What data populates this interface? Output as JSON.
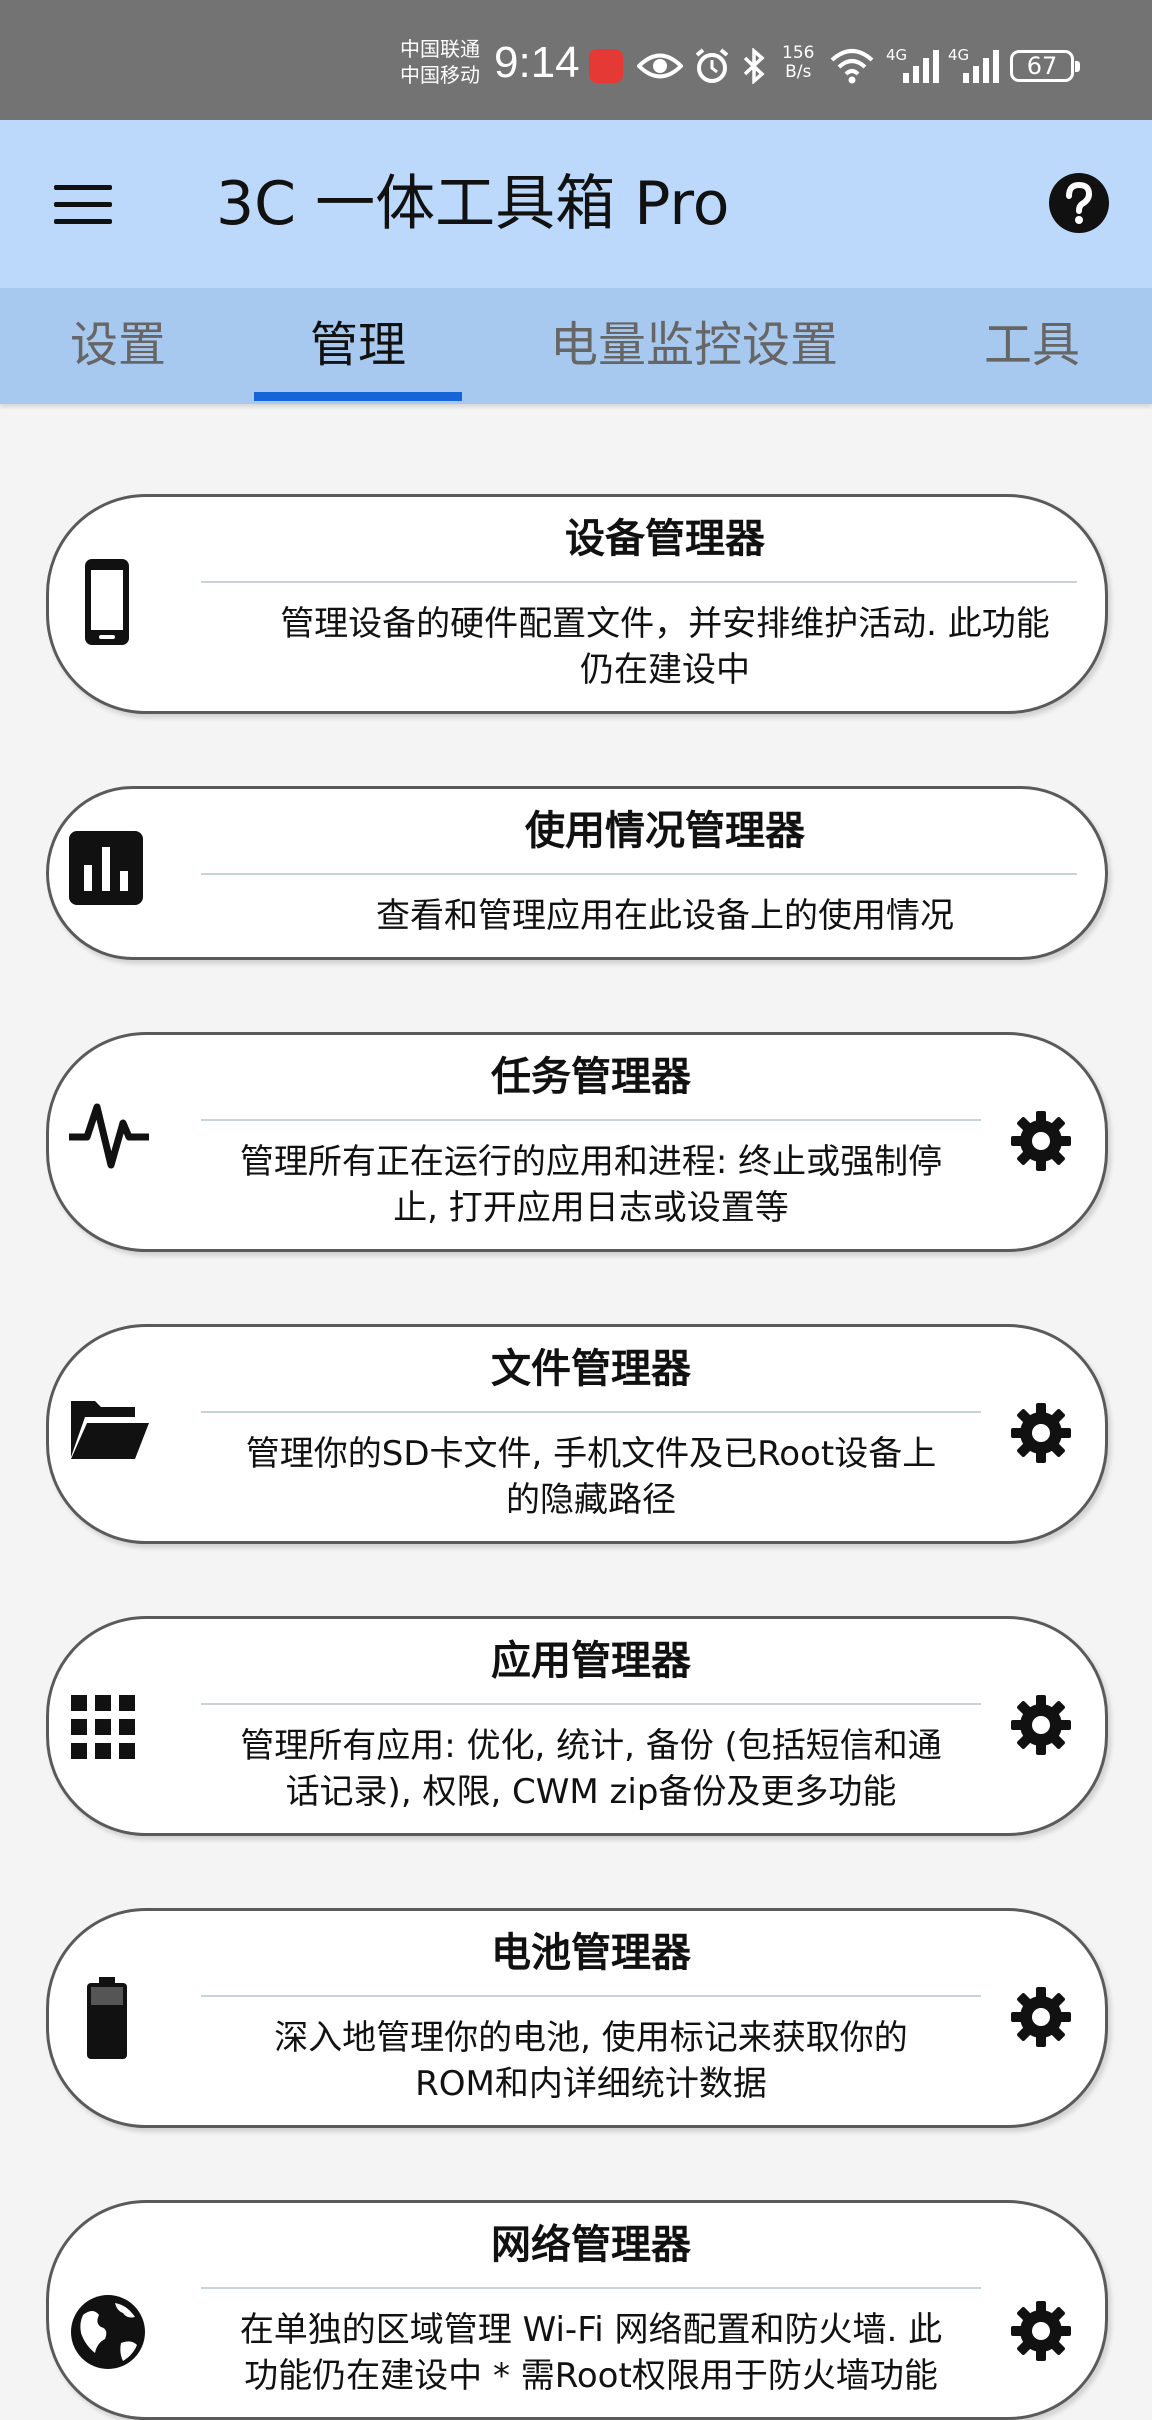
{
  "status_bar": {
    "carrier_1": "中国联通",
    "carrier_2": "中国移动",
    "time": "9:14",
    "net_speed_value": "156",
    "net_speed_unit": "B/s",
    "network_1": "4G",
    "network_2": "4G",
    "battery": "67"
  },
  "app_bar": {
    "title": "3C 一体工具箱 Pro"
  },
  "tabs": [
    {
      "label": "设置",
      "active": false
    },
    {
      "label": "管理",
      "active": true
    },
    {
      "label": "电量监控设置",
      "active": false
    },
    {
      "label": "工具",
      "active": false
    }
  ],
  "cards": [
    {
      "title": "设备管理器",
      "icon": "phone-icon",
      "has_settings": false,
      "desc": [
        "管理设备的硬件配置文件，并安排维护活动. 此功能",
        "仍在建设中"
      ]
    },
    {
      "title": "使用情况管理器",
      "icon": "bar-chart-icon",
      "has_settings": false,
      "desc": [
        "查看和管理应用在此设备上的使用情况"
      ]
    },
    {
      "title": "任务管理器",
      "icon": "activity-icon",
      "has_settings": true,
      "desc": [
        "管理所有正在运行的应用和进程: 终止或强制停",
        "止, 打开应用日志或设置等"
      ]
    },
    {
      "title": "文件管理器",
      "icon": "folder-open-icon",
      "has_settings": true,
      "desc": [
        "管理你的SD卡文件, 手机文件及已Root设备上",
        "的隐藏路径"
      ]
    },
    {
      "title": "应用管理器",
      "icon": "apps-grid-icon",
      "has_settings": true,
      "desc": [
        "管理所有应用: 优化, 统计, 备份 (包括短信和通",
        "话记录), 权限, CWM zip备份及更多功能"
      ]
    },
    {
      "title": "电池管理器",
      "icon": "battery-icon",
      "has_settings": true,
      "desc": [
        "深入地管理你的电池, 使用标记来获取你的",
        "ROM和内详细统计数据"
      ]
    },
    {
      "title": "网络管理器",
      "icon": "globe-icon",
      "has_settings": true,
      "desc": [
        "在单独的区域管理 Wi-Fi 网络配置和防火墙. 此",
        "功能仍在建设中 * 需Root权限用于防火墙功能"
      ]
    }
  ]
}
